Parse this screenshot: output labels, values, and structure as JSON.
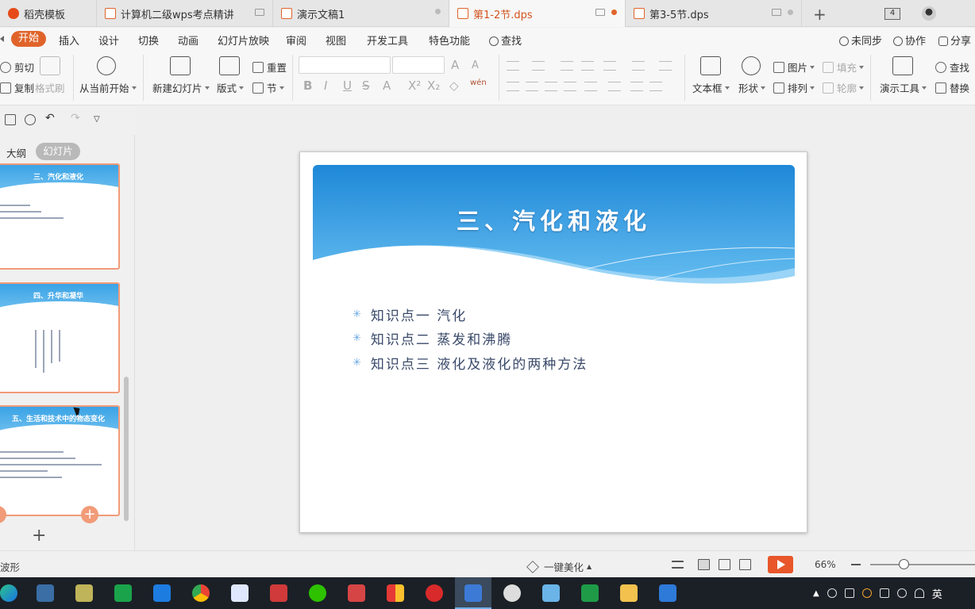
{
  "tabs": [
    {
      "label": "稻壳模板",
      "icon": "docer-icon"
    },
    {
      "label": "计算机二级wps考点精讲",
      "icon": "presentation-file-icon"
    },
    {
      "label": "演示文稿1",
      "icon": "presentation-file-icon"
    },
    {
      "label": "第1-2节.dps",
      "icon": "presentation-file-icon",
      "active": true
    },
    {
      "label": "第3-5节.dps",
      "icon": "presentation-file-icon"
    }
  ],
  "window_count": "4",
  "menu": {
    "start": "开始",
    "items": [
      "插入",
      "设计",
      "切换",
      "动画",
      "幻灯片放映",
      "审阅",
      "视图",
      "开发工具",
      "特色功能"
    ],
    "search": "查找",
    "right": [
      "未同步",
      "协作",
      "分享"
    ]
  },
  "ribbon": {
    "cut": "剪切",
    "copy": "复制",
    "format_painter": "格式刷",
    "from_current": "从当前开始",
    "new_slide": "新建幻灯片",
    "layout": "版式",
    "reset": "重置",
    "section": "节",
    "textbox": "文本框",
    "shape": "形状",
    "picture": "图片",
    "fill": "填充",
    "arrange": "排列",
    "outline": "轮廓",
    "present_tools": "演示工具",
    "find": "查找",
    "replace": "替换",
    "phonetic": "wén"
  },
  "panel": {
    "outline_tab": "大纲",
    "slides_tab": "幻灯片",
    "thumbs": [
      {
        "title": "三、汽化和液化"
      },
      {
        "title": "四、升华和凝华"
      },
      {
        "title": "五、生活和技术中的物态变化"
      }
    ]
  },
  "slide": {
    "title": "三、汽化和液化",
    "bullets": [
      "知识点一 汽化",
      "知识点二 蒸发和沸腾",
      "知识点三 液化及液化的两种方法"
    ]
  },
  "status": {
    "left_text": "波形",
    "beautify": "一键美化",
    "zoom": "66%"
  },
  "tray": {
    "ime": "英"
  },
  "colors": {
    "accent": "#e0642a",
    "slide_blue": "#2d8fdc",
    "bullet_star": "#6aa9e0"
  }
}
